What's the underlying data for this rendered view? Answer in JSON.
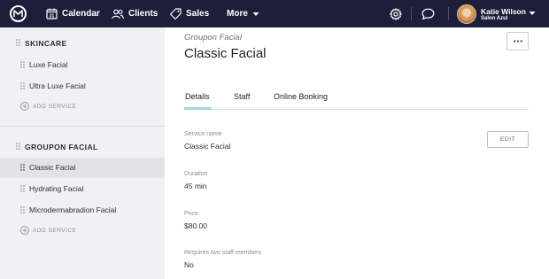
{
  "topnav": {
    "logo_icon": "brand-logo-icon",
    "items": [
      {
        "label": "Calendar",
        "icon": "calendar-icon",
        "icon_text": "31"
      },
      {
        "label": "Clients",
        "icon": "clients-icon"
      },
      {
        "label": "Sales",
        "icon": "tag-icon"
      },
      {
        "label": "More",
        "icon": "chevron-down-icon"
      }
    ],
    "settings_icon": "gear-icon",
    "chat_icon": "chat-icon",
    "user": {
      "name": "Katie Wilson",
      "salon": "Salon Azul"
    },
    "colors": {
      "background": "#1d1f3a",
      "text": "#ffffff"
    }
  },
  "sidebar": {
    "categories": [
      {
        "name": "SKINCARE",
        "services": [
          {
            "label": "Luxe Facial",
            "selected": false
          },
          {
            "label": "Ultra Luxe Facial",
            "selected": false
          }
        ],
        "add_label": "ADD SERVICE"
      },
      {
        "name": "GROUPON FACIAL",
        "services": [
          {
            "label": "Classic Facial",
            "selected": true
          },
          {
            "label": "Hydrating Facial",
            "selected": false
          },
          {
            "label": "Microdermabradion Facial",
            "selected": false
          }
        ],
        "add_label": "ADD SERVICE"
      }
    ],
    "colors": {
      "background": "#f1f1f3",
      "selected": "#e3e3e7"
    }
  },
  "main": {
    "subtitle": "Groupon Facial",
    "title": "Classic Facial",
    "more_icon": "more-horizontal-icon",
    "tabs": [
      {
        "label": "Details",
        "active": true
      },
      {
        "label": "Staff",
        "active": false
      },
      {
        "label": "Online Booking",
        "active": false
      }
    ],
    "edit_label": "EDIT",
    "fields": [
      {
        "label": "Service name",
        "value": "Classic Facial"
      },
      {
        "label": "Duration",
        "value": "45 min"
      },
      {
        "label": "Price",
        "value": "$80.00"
      },
      {
        "label": "Requires two staff members",
        "value": "No"
      }
    ],
    "colors": {
      "tab_underline": "#9fd8dc"
    }
  }
}
